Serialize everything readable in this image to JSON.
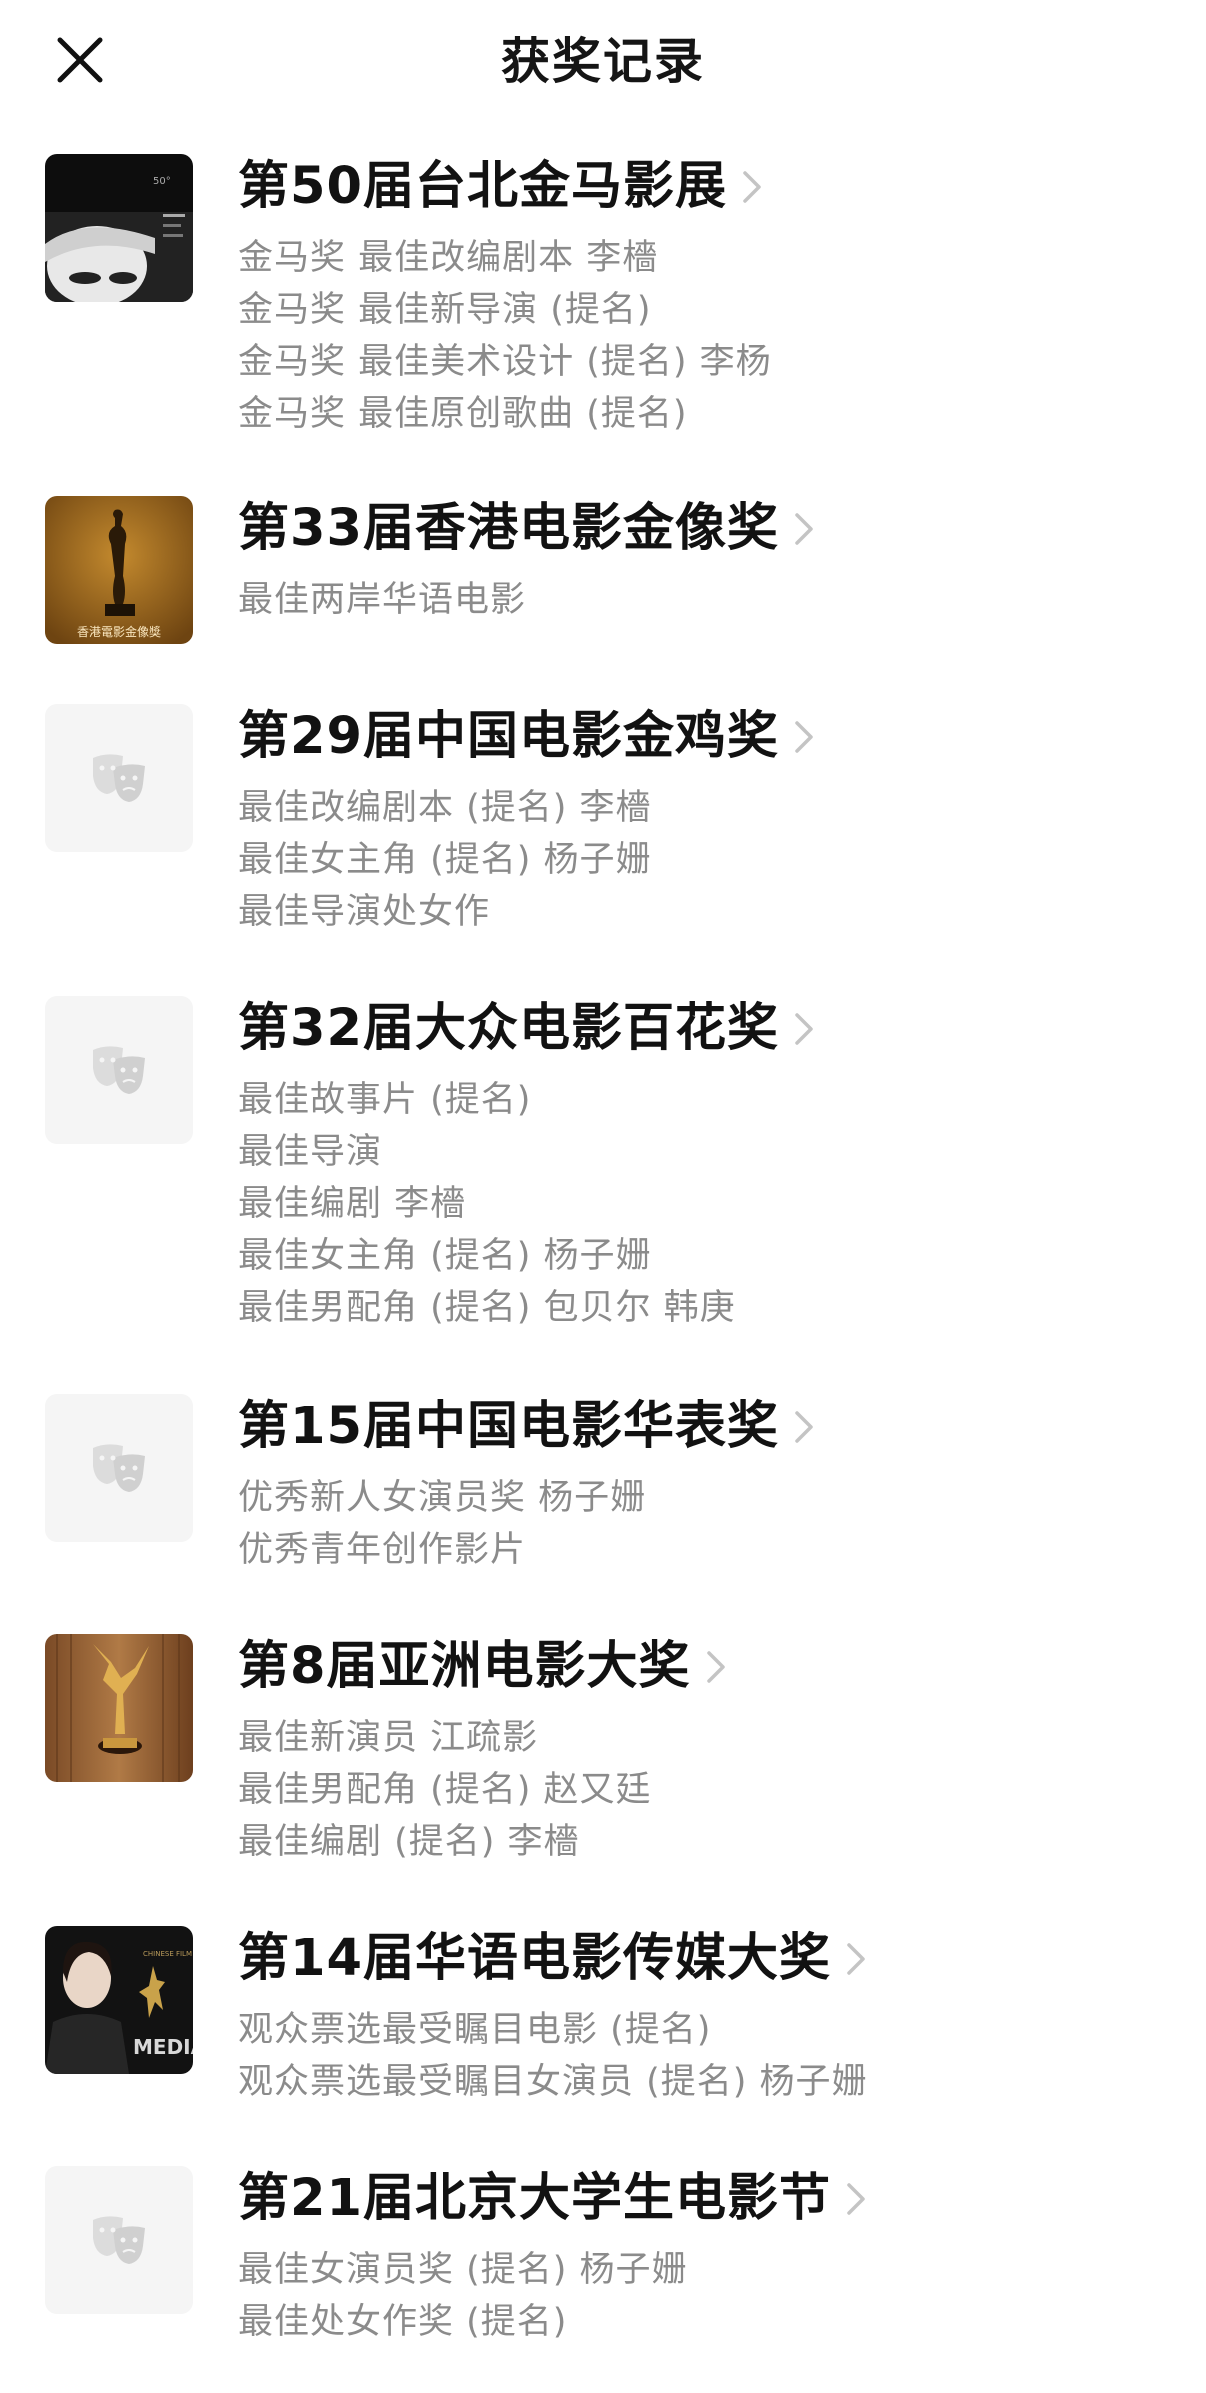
{
  "header": {
    "title": "获奖记录",
    "close_icon": "close-icon"
  },
  "colors": {
    "title_text": "#121212",
    "secondary_text": "#8b8b8b",
    "chevron": "#c4c4c4",
    "placeholder_bg": "#f5f5f5",
    "placeholder_icon": "#d9d9d9"
  },
  "awards": [
    {
      "title": "第50届台北金马影展",
      "thumbnail": "festival-poster-image",
      "entries": [
        "金马奖 最佳改编剧本 李檣",
        "金马奖 最佳新导演 (提名)",
        "金马奖 最佳美术设计 (提名) 李杨",
        "金马奖 最佳原创歌曲 (提名)"
      ]
    },
    {
      "title": "第33届香港电影金像奖",
      "thumbnail": "trophy-image",
      "thumbnail_caption": "香港電影金像獎",
      "entries": [
        "最佳两岸华语电影"
      ]
    },
    {
      "title": "第29届中国电影金鸡奖",
      "thumbnail": "theater-masks-icon",
      "entries": [
        "最佳改编剧本 (提名) 李檣",
        "最佳女主角 (提名) 杨子姗",
        "最佳导演处女作"
      ]
    },
    {
      "title": "第32届大众电影百花奖",
      "thumbnail": "theater-masks-icon",
      "entries": [
        "最佳故事片 (提名)",
        "最佳导演",
        "最佳编剧 李檣",
        "最佳女主角 (提名) 杨子姗",
        "最佳男配角 (提名) 包贝尔 韩庚"
      ]
    },
    {
      "title": "第15届中国电影华表奖",
      "thumbnail": "theater-masks-icon",
      "entries": [
        "优秀新人女演员奖 杨子姗",
        "优秀青年创作影片"
      ]
    },
    {
      "title": "第8届亚洲电影大奖",
      "thumbnail": "trophy-image",
      "entries": [
        "最佳新演员 江疏影",
        "最佳男配角 (提名) 赵又廷",
        "最佳编剧 (提名) 李檣"
      ]
    },
    {
      "title": "第14届华语电影传媒大奖",
      "thumbnail": "media-award-poster-image",
      "thumbnail_caption": "MEDIA",
      "entries": [
        "观众票选最受瞩目电影 (提名)",
        "观众票选最受瞩目女演员 (提名) 杨子姗"
      ]
    },
    {
      "title": "第21届北京大学生电影节",
      "thumbnail": "theater-masks-icon",
      "entries": [
        "最佳女演员奖 (提名) 杨子姗",
        "最佳处女作奖 (提名)"
      ]
    }
  ]
}
